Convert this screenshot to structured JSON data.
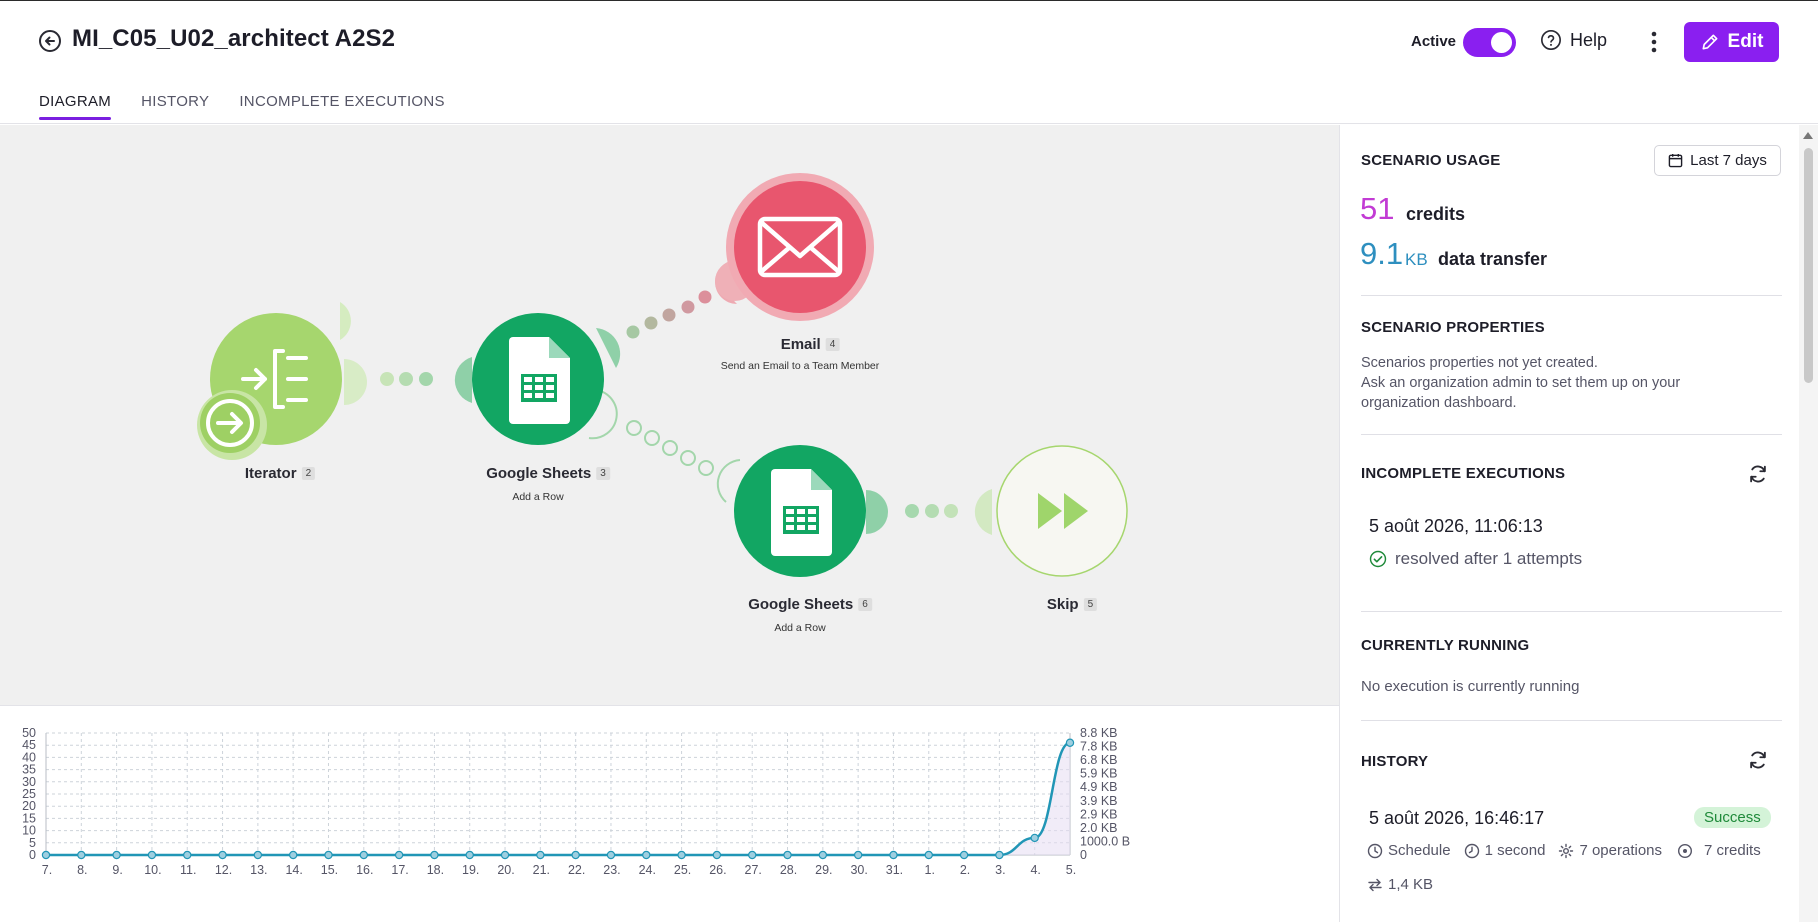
{
  "header": {
    "title": "MI_C05_U02_architect A2S2",
    "active_label": "Active",
    "help_label": "Help",
    "edit_label": "Edit",
    "tabs": [
      {
        "label": "DIAGRAM"
      },
      {
        "label": "HISTORY"
      },
      {
        "label": "INCOMPLETE EXECUTIONS"
      }
    ],
    "toggle_on": true,
    "accent_color": "#8a1ff0"
  },
  "diagram": {
    "nodes": [
      {
        "name": "Iterator",
        "badge": "2",
        "subtitle": "",
        "icon": "iterator-icon",
        "color": "#a6d66e"
      },
      {
        "name": "Google Sheets",
        "badge": "3",
        "subtitle": "Add a Row",
        "icon": "google-sheets-icon",
        "color": "#12a663"
      },
      {
        "name": "Email",
        "badge": "4",
        "subtitle": "Send an Email to a Team Member",
        "icon": "envelope-icon",
        "color": "#e8566e"
      },
      {
        "name": "Google Sheets",
        "badge": "6",
        "subtitle": "Add a Row",
        "icon": "google-sheets-icon",
        "color": "#12a663"
      },
      {
        "name": "Skip",
        "badge": "5",
        "subtitle": "",
        "icon": "skip-icon",
        "color": "#9fd56b"
      }
    ],
    "trigger_icon": "arrow-right-circle-icon"
  },
  "chart_data": {
    "type": "line",
    "x": [
      "7.",
      "8.",
      "9.",
      "10.",
      "11.",
      "12.",
      "13.",
      "14.",
      "15.",
      "16.",
      "17.",
      "18.",
      "19.",
      "20.",
      "21.",
      "22.",
      "23.",
      "24.",
      "25.",
      "26.",
      "27.",
      "28.",
      "29.",
      "30.",
      "31.",
      "1.",
      "2.",
      "3.",
      "4.",
      "5."
    ],
    "series": [
      {
        "values": [
          0,
          0,
          0,
          0,
          0,
          0,
          0,
          0,
          0,
          0,
          0,
          0,
          0,
          0,
          0,
          0,
          0,
          0,
          0,
          0,
          0,
          0,
          0,
          0,
          0,
          0,
          0,
          0,
          7,
          46
        ]
      }
    ],
    "left_ticks": [
      "0",
      "5",
      "10",
      "15",
      "20",
      "25",
      "30",
      "35",
      "40",
      "45",
      "50"
    ],
    "right_ticks": [
      "0",
      "1000.0 B",
      "2.0 KB",
      "2.9 KB",
      "3.9 KB",
      "4.9 KB",
      "5.9 KB",
      "6.8 KB",
      "7.8 KB",
      "8.8 KB"
    ],
    "ylim": [
      0,
      50
    ],
    "grid": true,
    "line_color": "#2196b6"
  },
  "panel": {
    "usage": {
      "title": "SCENARIO USAGE",
      "range_label": "Last 7 days",
      "credits_value": "51",
      "credits_label": "credits",
      "transfer_value": "9.1",
      "transfer_unit": "KB",
      "transfer_label": "data transfer",
      "credits_color": "#c23bd4",
      "transfer_color": "#2e8fbf"
    },
    "properties": {
      "title": "SCENARIO PROPERTIES",
      "line1": "Scenarios properties not yet created.",
      "line2": "Ask an organization admin to set them up on your",
      "line3": "organization dashboard."
    },
    "incomplete": {
      "title": "INCOMPLETE EXECUTIONS",
      "timestamp": "5 août 2026, 11:06:13",
      "status": "resolved after 1 attempts"
    },
    "running": {
      "title": "CURRENTLY RUNNING",
      "text": "No execution is currently running"
    },
    "history": {
      "title": "HISTORY",
      "timestamp": "5 août 2026, 16:46:17",
      "status": "Success",
      "trigger": "Schedule",
      "duration": "1 second",
      "operations": "7 operations",
      "credits": "7 credits",
      "transfer": "1,4 KB"
    }
  }
}
